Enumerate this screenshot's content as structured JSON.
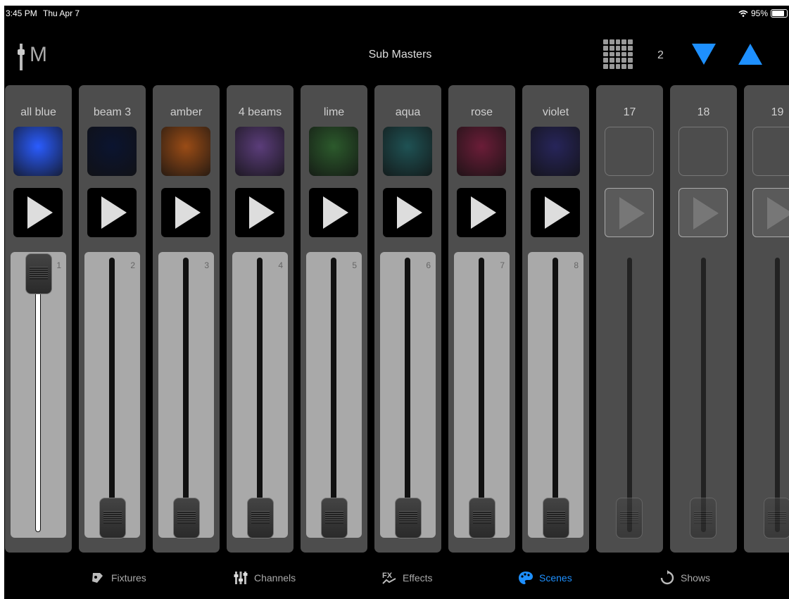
{
  "status": {
    "time": "3:45 PM",
    "date": "Thu Apr 7",
    "battery": "95%",
    "battery_level": 0.95
  },
  "header": {
    "logo_text": "M",
    "title": "Sub Masters",
    "page_number": "2"
  },
  "colors": {
    "accent": "#1e90ff"
  },
  "strips": [
    {
      "label": "all blue",
      "number": "1",
      "thumb": "#2a5cff",
      "fader_level": 1.0
    },
    {
      "label": "beam 3",
      "number": "2",
      "thumb": "#0b1430",
      "fader_level": 0
    },
    {
      "label": "amber",
      "number": "3",
      "thumb": "#9a4c16",
      "fader_level": 0
    },
    {
      "label": "4 beams",
      "number": "4",
      "thumb": "#5b3d7a",
      "fader_level": 0
    },
    {
      "label": "lime",
      "number": "5",
      "thumb": "#2c5a2c",
      "fader_level": 0
    },
    {
      "label": "aqua",
      "number": "6",
      "thumb": "#1f5254",
      "fader_level": 0
    },
    {
      "label": "rose",
      "number": "7",
      "thumb": "#6b1d38",
      "fader_level": 0
    },
    {
      "label": "violet",
      "number": "8",
      "thumb": "#27255a",
      "fader_level": 0
    },
    {
      "label": "17",
      "number": "",
      "thumb": "",
      "fader_level": 0
    },
    {
      "label": "18",
      "number": "",
      "thumb": "",
      "fader_level": 0
    },
    {
      "label": "19",
      "number": "",
      "thumb": "",
      "fader_level": 0
    }
  ],
  "tabs": [
    {
      "label": "Fixtures",
      "icon": "fixtures-icon"
    },
    {
      "label": "Channels",
      "icon": "channels-icon"
    },
    {
      "label": "Effects",
      "icon": "effects-icon"
    },
    {
      "label": "Scenes",
      "icon": "scenes-icon",
      "active": true
    },
    {
      "label": "Shows",
      "icon": "shows-icon"
    }
  ]
}
